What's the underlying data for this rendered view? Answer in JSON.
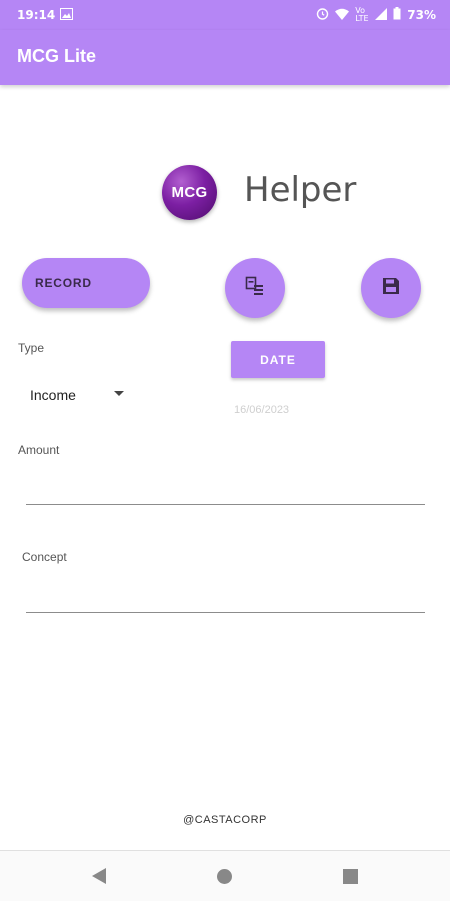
{
  "status_bar": {
    "time": "19:14",
    "network_label": "Vo LTE",
    "battery": "73%"
  },
  "app_bar": {
    "title": "MCG Lite"
  },
  "header": {
    "logo_text": "MCG",
    "title": "Helper"
  },
  "actions": {
    "record_label": "RECORD"
  },
  "form": {
    "type_label": "Type",
    "type_value": "Income",
    "date_button_label": "DATE",
    "date_value": "16/06/2023",
    "amount_label": "Amount",
    "concept_label": "Concept"
  },
  "footer": {
    "credit": "@CASTACORP"
  },
  "colors": {
    "accent": "#b586f5",
    "logo": "#7c1fa3",
    "icon_dark": "#3a2a4a"
  },
  "icons": [
    "gallery-icon",
    "alarm-icon",
    "wifi-icon",
    "signal-icon",
    "battery-icon",
    "list-icon",
    "save-icon",
    "dropdown-arrow-icon",
    "back-icon",
    "home-icon",
    "recents-icon"
  ]
}
